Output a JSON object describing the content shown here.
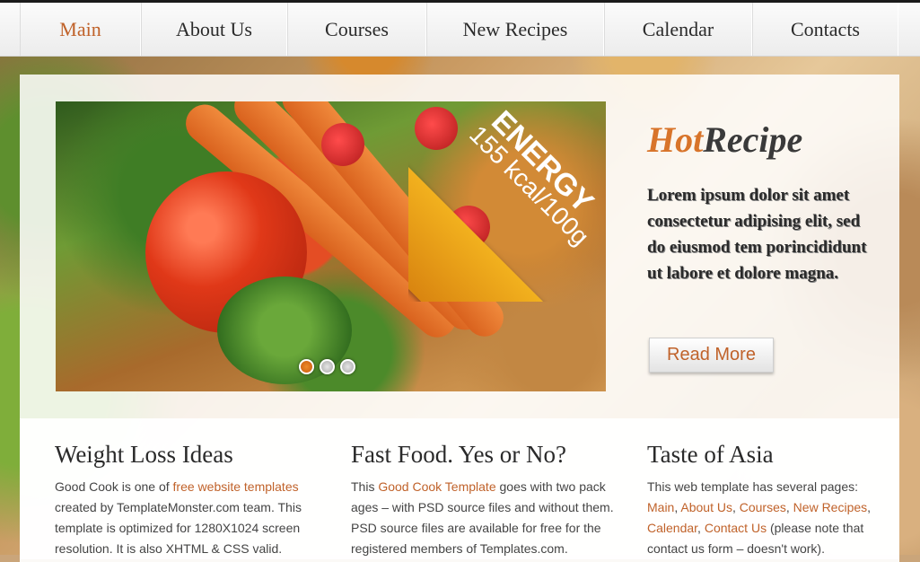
{
  "nav": {
    "items": [
      {
        "label": "Main",
        "active": true
      },
      {
        "label": "About Us"
      },
      {
        "label": "Courses"
      },
      {
        "label": "New Recipes"
      },
      {
        "label": "Calendar"
      },
      {
        "label": "Contacts"
      }
    ]
  },
  "slider": {
    "ribbon_title": "ENERGY",
    "ribbon_sub": "155 kcal/100g",
    "dots_count": 3,
    "active_dot": 1
  },
  "hot_recipe": {
    "title_hot": "Hot",
    "title_recipe": "Recipe",
    "text": "Lorem ipsum dolor sit amet consectetur adipising elit, sed do eiusmod tem porincididunt ut labore et dolore magna.",
    "button": "Read More"
  },
  "columns": [
    {
      "title": "Weight Loss Ideas",
      "t1": "Good Cook is one of ",
      "link1": "free website templates",
      "t2": " created by TemplateMonster.com team. This template is optimized for 1280X1024 screen resolution. It is also XHTML & CSS valid."
    },
    {
      "title": "Fast Food. Yes or No?",
      "t1": "This ",
      "link1": "Good Cook Template",
      "t2": " goes with two pack ages – with PSD source files and without them. PSD source files are available for free for the registered members of Templates.com."
    },
    {
      "title": "Taste of Asia",
      "t1": "This web template has several pages: ",
      "links": [
        "Main",
        "About Us",
        "Courses",
        "New Recipes",
        "Calendar",
        "Contact Us"
      ],
      "sep": ", ",
      "t2": " (please note that contact us form – doesn't work)."
    }
  ],
  "colors": {
    "accent": "#c0622a",
    "ribbon": "#e69a16",
    "hot": "#d8742a"
  }
}
